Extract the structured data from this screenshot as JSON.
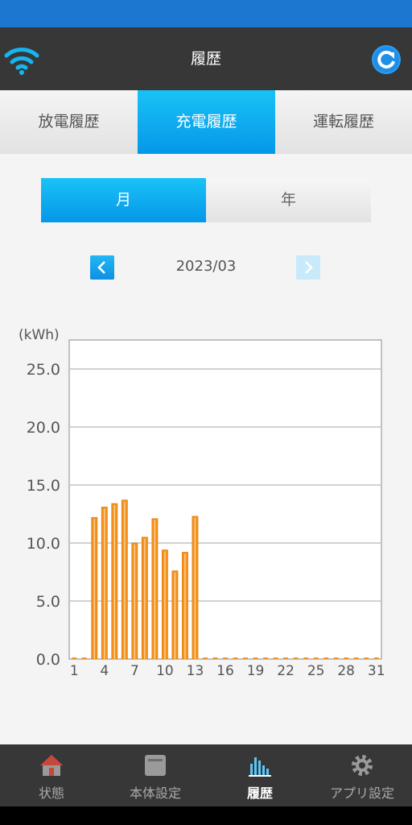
{
  "header": {
    "title": "履歴"
  },
  "tabs": [
    {
      "label": "放電履歴",
      "active": false
    },
    {
      "label": "充電履歴",
      "active": true
    },
    {
      "label": "運転履歴",
      "active": false
    }
  ],
  "period_toggle": {
    "month": "月",
    "year": "年",
    "selected": "月"
  },
  "date_nav": {
    "current": "2023/03"
  },
  "chart_data": {
    "type": "bar",
    "ylabel": "(kWh)",
    "ylim": [
      0,
      27.5
    ],
    "yticks": [
      "0.0",
      "5.0",
      "10.0",
      "15.0",
      "20.0",
      "25.0"
    ],
    "x": [
      1,
      2,
      3,
      4,
      5,
      6,
      7,
      8,
      9,
      10,
      11,
      12,
      13,
      14,
      15,
      16,
      17,
      18,
      19,
      20,
      21,
      22,
      23,
      24,
      25,
      26,
      27,
      28,
      29,
      30,
      31
    ],
    "xticks": [
      "1",
      "4",
      "7",
      "10",
      "13",
      "16",
      "19",
      "22",
      "25",
      "28",
      "31"
    ],
    "values": [
      0,
      0,
      12.2,
      13.1,
      13.4,
      13.7,
      10.0,
      10.5,
      12.1,
      9.4,
      7.6,
      9.2,
      12.3,
      0,
      0,
      0,
      0,
      0,
      0,
      0,
      0,
      0,
      0,
      0,
      0,
      0,
      0,
      0,
      0,
      0,
      0
    ],
    "bar_color": "#f5941f",
    "grid": true
  },
  "bottom_nav": [
    {
      "label": "状態",
      "icon": "home-icon",
      "active": false
    },
    {
      "label": "本体設定",
      "icon": "device-icon",
      "active": false
    },
    {
      "label": "履歴",
      "icon": "bar-chart-icon",
      "active": true
    },
    {
      "label": "アプリ設定",
      "icon": "gear-icon",
      "active": false
    }
  ],
  "colors": {
    "accent": "#0aa6ee",
    "appbar": "#373737",
    "statusbar": "#1b77d0"
  }
}
